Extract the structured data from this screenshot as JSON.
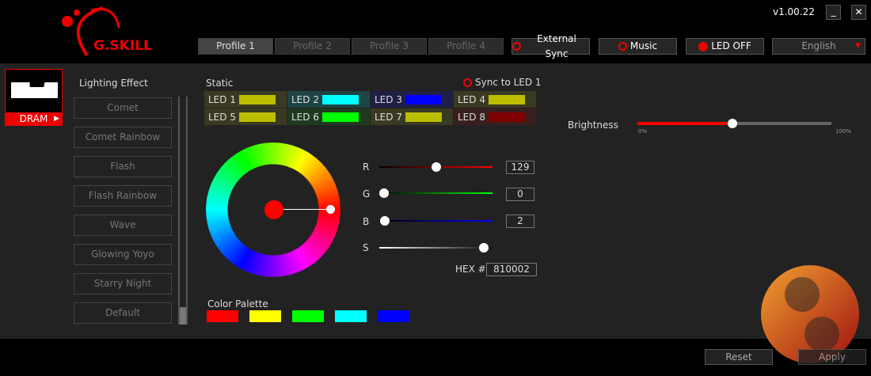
{
  "header": {
    "logo_text": "G.SKILL",
    "version": "v1.00.22",
    "profiles": [
      "Profile 1",
      "Profile 2",
      "Profile 3",
      "Profile 4"
    ],
    "external_sync": "External Sync",
    "music": "Music",
    "led_off": "LED OFF",
    "language": "English"
  },
  "device": {
    "label": "DRAM"
  },
  "lighting": {
    "title": "Lighting Effect",
    "effects": [
      "Comet",
      "Comet Rainbow",
      "Flash",
      "Flash Rainbow",
      "Wave",
      "Glowing Yoyo",
      "Starry Night",
      "Default"
    ]
  },
  "static": {
    "title": "Static",
    "sync": "Sync to LED 1",
    "leds": [
      {
        "label": "LED 1",
        "color": "#bdbd00",
        "bg": "#3a3a22"
      },
      {
        "label": "LED 2",
        "color": "#00ffff",
        "bg": "#1f4444"
      },
      {
        "label": "LED 3",
        "color": "#0000ff",
        "bg": "#1f1f44"
      },
      {
        "label": "LED 4",
        "color": "#bdbd00",
        "bg": "#3a3a22"
      },
      {
        "label": "LED 5",
        "color": "#bdbd00",
        "bg": "#3a3a22"
      },
      {
        "label": "LED 6",
        "color": "#00ff00",
        "bg": "#1f3a1f"
      },
      {
        "label": "LED 7",
        "color": "#bdbd00",
        "bg": "#3a3a22"
      },
      {
        "label": "LED 8",
        "color": "#800000",
        "bg": "#3a1f1f"
      }
    ]
  },
  "color": {
    "r_label": "R",
    "g_label": "G",
    "b_label": "B",
    "s_label": "S",
    "r": "129",
    "g": "0",
    "b": "2",
    "s_percent": 92,
    "hex_label": "HEX #",
    "hex": "810002"
  },
  "palette": {
    "title": "Color Palette",
    "colors": [
      "#ff0000",
      "#ffff00",
      "#00ff00",
      "#00ffff",
      "#0000ff"
    ]
  },
  "brightness": {
    "label": "Brightness",
    "min": "0%",
    "max": "100%",
    "value_percent": 49
  },
  "footer": {
    "reset": "Reset",
    "apply": "Apply"
  }
}
